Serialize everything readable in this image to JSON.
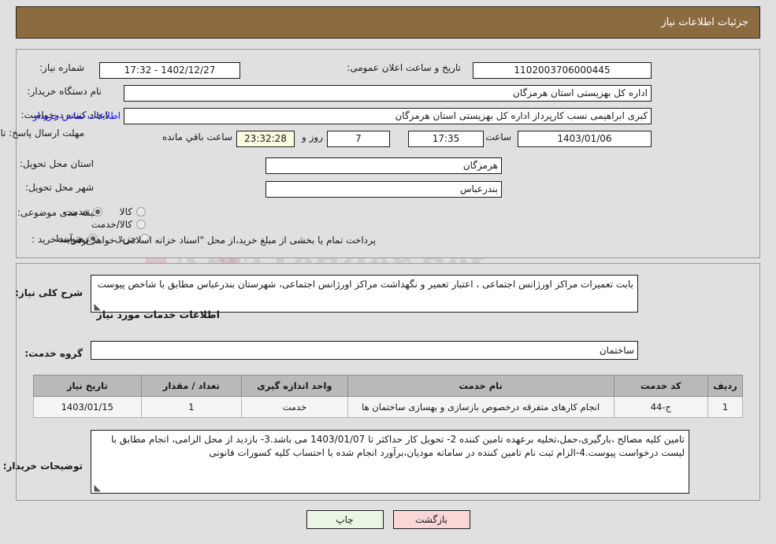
{
  "header": {
    "title": "جزئیات اطلاعات نیاز",
    "bar_color": "#8c6b41"
  },
  "form": {
    "need_number_label": "شماره نیاز:",
    "need_number_value": "1102003706000445",
    "announce_label": "تاریخ و ساعت اعلان عمومی:",
    "announce_value": "1402/12/27 - 17:32",
    "buyer_org_label": "نام دستگاه خریدار:",
    "buyer_org_value": "اداره کل بهزیستی استان هرمزگان",
    "requester_label": "ایجاد کننده درخواست:",
    "requester_value": "کبری  ابراهیمی نسب کارپرداز اداره کل بهزیستی استان هرمزگان",
    "contact_link": "اطلاعات تماس خریدار",
    "deadline_label": "مهلت ارسال پاسخ: تا تاریخ:",
    "deadline_date": "1403/01/06",
    "hour_label": "ساعت",
    "deadline_time": "17:35",
    "days_value": "7",
    "days_label": "روز و",
    "countdown_value": "23:32:28",
    "remaining_label": "ساعت باقي مانده",
    "province_label": "استان محل تحویل:",
    "province_value": "هرمزگان",
    "city_label": "شهر محل تحویل:",
    "city_value": "بندرعباس",
    "category_label": "طبقه بندی موضوعی:",
    "category_options": [
      {
        "label": "کالا",
        "selected": false
      },
      {
        "label": "خدمت",
        "selected": true
      },
      {
        "label": "کالا/خدمت",
        "selected": false
      }
    ],
    "process_label": "نوع فرآیند خرید :",
    "process_options": [
      {
        "label": "جزیی",
        "selected": false
      },
      {
        "label": "متوسط",
        "selected": true
      }
    ],
    "process_note": "پرداخت تمام یا بخشی از مبلغ خرید،از محل \"اسناد خزانه اسلامی\" خواهد بود."
  },
  "details": {
    "summary_label": "شرح کلی نیاز:",
    "summary_value": "بابت تعمیرات مراکز اورژانس اجتماعی ، اعتبار تعمیر و نگهداشت مراکز  اورژانس اجتماعی، شهرستان بندرعباس  مطابق با شاخص پیوست",
    "services_heading": "اطلاعات خدمات مورد نیاز",
    "service_group_label": "گروه خدمت:",
    "service_group_value": "ساختمان"
  },
  "table": {
    "columns": [
      "ردیف",
      "کد خدمت",
      "نام خدمت",
      "واحد اندازه گیری",
      "تعداد / مقدار",
      "تاریخ نیاز"
    ],
    "rows": [
      {
        "row_no": "1",
        "service_code": "ج-44",
        "service_name": "انجام کارهای متفرقه درخصوص بازسازی و بهسازی ساختمان ها",
        "unit": "خدمت",
        "quantity": "1",
        "need_date": "1403/01/15"
      }
    ]
  },
  "notes": {
    "label": "توضیحات خریدار:",
    "value": "تامین کلیه مصالح ،بارگیری،حمل،تخلیه برعهده تامین کننده 2- تحویل کار حداکثر تا 1403/01/07 می باشد.3- بازدید از محل الزامی، انجام مطابق با لیست درخواست پیوست.4-الزام ثبت نام تامین کننده در سامانه مودیان،برآورد انجام شده با احتساب کلیه کسورات قانونی"
  },
  "footer": {
    "print_label": "چاپ",
    "back_label": "بازگشت"
  }
}
